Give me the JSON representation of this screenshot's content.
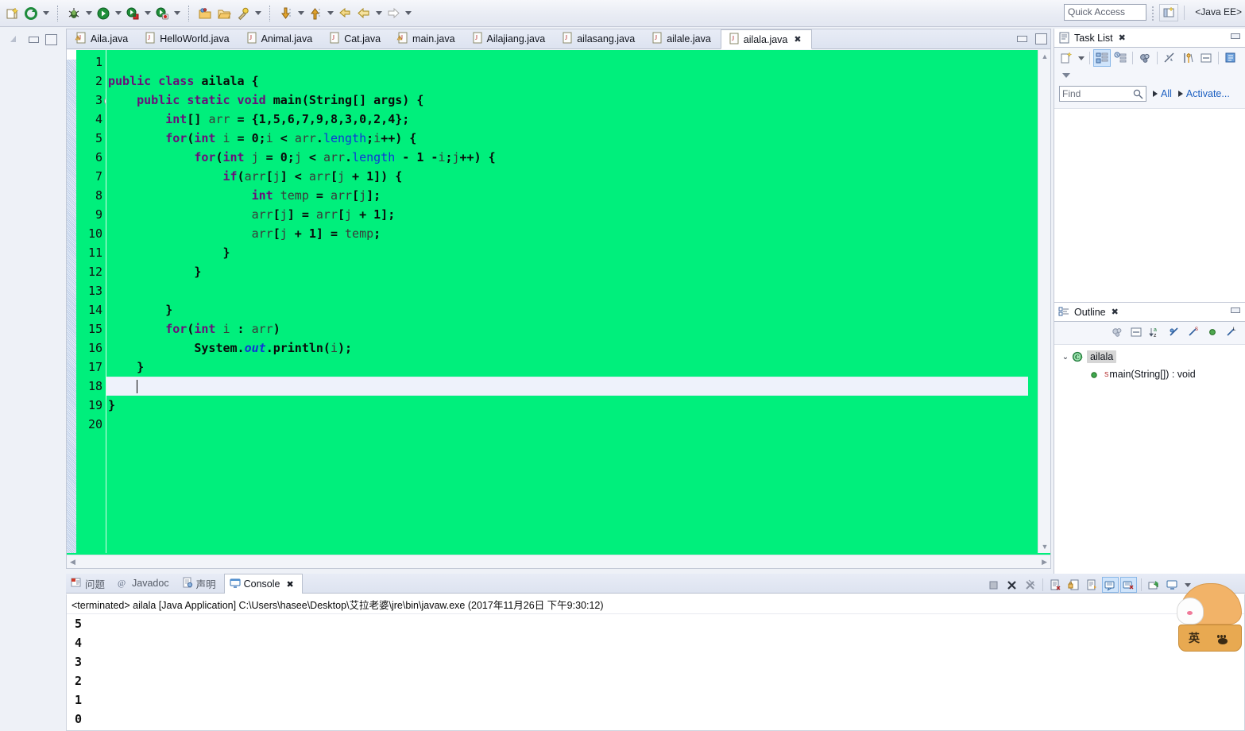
{
  "toolbar": {
    "buttons": [
      {
        "name": "new-wizard-icon",
        "label": "New"
      },
      {
        "name": "refresh-icon",
        "label": "Refresh"
      },
      {
        "name": "debug-icon",
        "label": "Debug"
      },
      {
        "name": "run-icon",
        "label": "Run"
      },
      {
        "name": "run-external-tools-icon",
        "label": "External Tools"
      },
      {
        "name": "run-as-server-icon",
        "label": "Run As"
      },
      {
        "name": "open-folder-icon",
        "label": "Open Resource"
      },
      {
        "name": "open-type-icon",
        "label": "Open Type"
      },
      {
        "name": "search-icon",
        "label": "Search"
      },
      {
        "name": "next-annotation-icon",
        "label": "Next Annotation"
      },
      {
        "name": "previous-annotation-icon",
        "label": "Previous Annotation"
      },
      {
        "name": "back-icon",
        "label": "Back"
      },
      {
        "name": "last-edit-icon",
        "label": "Last Edit Location"
      },
      {
        "name": "forward-icon",
        "label": "Forward"
      }
    ],
    "quick_access_placeholder": "Quick Access",
    "perspective_label": "<Java EE>",
    "perspective_open_icon": "open-perspective-icon"
  },
  "editor": {
    "tabs": [
      {
        "label": "Aila.java",
        "active": false,
        "warning": true
      },
      {
        "label": "HelloWorld.java",
        "active": false,
        "warning": false
      },
      {
        "label": "Animal.java",
        "active": false,
        "warning": false
      },
      {
        "label": "Cat.java",
        "active": false,
        "warning": false
      },
      {
        "label": "main.java",
        "active": false,
        "warning": true
      },
      {
        "label": "Ailajiang.java",
        "active": false,
        "warning": false
      },
      {
        "label": "ailasang.java",
        "active": false,
        "warning": false
      },
      {
        "label": "ailale.java",
        "active": false,
        "warning": false
      },
      {
        "label": "ailala.java",
        "active": true,
        "warning": false
      }
    ],
    "close_glyph": "✖",
    "background_color": "#00ef7c",
    "current_line_color": "#eef2fb",
    "line_numbers": [
      "1",
      "2",
      "3",
      "4",
      "5",
      "6",
      "7",
      "8",
      "9",
      "10",
      "11",
      "12",
      "13",
      "14",
      "15",
      "16",
      "17",
      "18",
      "19",
      "20"
    ],
    "current_line": 18,
    "fold_marker_line": 3,
    "code_lines": [
      {
        "n": 1,
        "tokens": []
      },
      {
        "n": 2,
        "tokens": [
          {
            "t": "public class ",
            "c": "kw"
          },
          {
            "t": "ailala {",
            "c": "plain"
          }
        ]
      },
      {
        "n": 3,
        "tokens": [
          {
            "t": "    public static void ",
            "c": "kw"
          },
          {
            "t": "main(String[] args) {",
            "c": "plain"
          }
        ]
      },
      {
        "n": 4,
        "tokens": [
          {
            "t": "        ",
            "c": "plain"
          },
          {
            "t": "int",
            "c": "kw"
          },
          {
            "t": "[] ",
            "c": "plain"
          },
          {
            "t": "arr",
            "c": "var"
          },
          {
            "t": " = {1,5,6,7,9,8,3,0,2,4};",
            "c": "plain"
          }
        ]
      },
      {
        "n": 5,
        "tokens": [
          {
            "t": "        ",
            "c": "plain"
          },
          {
            "t": "for",
            "c": "kw"
          },
          {
            "t": "(",
            "c": "plain"
          },
          {
            "t": "int",
            "c": "kw"
          },
          {
            "t": " ",
            "c": "plain"
          },
          {
            "t": "i",
            "c": "var"
          },
          {
            "t": " = ",
            "c": "plain"
          },
          {
            "t": "0;",
            "c": "plain"
          },
          {
            "t": "i",
            "c": "var"
          },
          {
            "t": " < ",
            "c": "plain"
          },
          {
            "t": "arr",
            "c": "var"
          },
          {
            "t": ".",
            "c": "plain"
          },
          {
            "t": "length",
            "c": "fld"
          },
          {
            "t": ";",
            "c": "plain"
          },
          {
            "t": "i",
            "c": "var"
          },
          {
            "t": "++) {",
            "c": "plain"
          }
        ]
      },
      {
        "n": 6,
        "tokens": [
          {
            "t": "            ",
            "c": "plain"
          },
          {
            "t": "for",
            "c": "kw"
          },
          {
            "t": "(",
            "c": "plain"
          },
          {
            "t": "int",
            "c": "kw"
          },
          {
            "t": " ",
            "c": "plain"
          },
          {
            "t": "j",
            "c": "var"
          },
          {
            "t": " = ",
            "c": "plain"
          },
          {
            "t": "0;",
            "c": "plain"
          },
          {
            "t": "j",
            "c": "var"
          },
          {
            "t": " < ",
            "c": "plain"
          },
          {
            "t": "arr",
            "c": "var"
          },
          {
            "t": ".",
            "c": "plain"
          },
          {
            "t": "length",
            "c": "fld"
          },
          {
            "t": " - 1 -",
            "c": "plain"
          },
          {
            "t": "i",
            "c": "var"
          },
          {
            "t": ";",
            "c": "plain"
          },
          {
            "t": "j",
            "c": "var"
          },
          {
            "t": "++) {",
            "c": "plain"
          }
        ]
      },
      {
        "n": 7,
        "tokens": [
          {
            "t": "                ",
            "c": "plain"
          },
          {
            "t": "if",
            "c": "kw"
          },
          {
            "t": "(",
            "c": "plain"
          },
          {
            "t": "arr",
            "c": "var"
          },
          {
            "t": "[",
            "c": "plain"
          },
          {
            "t": "j",
            "c": "var"
          },
          {
            "t": "] < ",
            "c": "plain"
          },
          {
            "t": "arr",
            "c": "var"
          },
          {
            "t": "[",
            "c": "plain"
          },
          {
            "t": "j",
            "c": "var"
          },
          {
            "t": " + 1]) {",
            "c": "plain"
          }
        ]
      },
      {
        "n": 8,
        "tokens": [
          {
            "t": "                    ",
            "c": "plain"
          },
          {
            "t": "int",
            "c": "kw"
          },
          {
            "t": " ",
            "c": "plain"
          },
          {
            "t": "temp",
            "c": "var"
          },
          {
            "t": " = ",
            "c": "plain"
          },
          {
            "t": "arr",
            "c": "var"
          },
          {
            "t": "[",
            "c": "plain"
          },
          {
            "t": "j",
            "c": "var"
          },
          {
            "t": "];",
            "c": "plain"
          }
        ]
      },
      {
        "n": 9,
        "tokens": [
          {
            "t": "                    ",
            "c": "plain"
          },
          {
            "t": "arr",
            "c": "var"
          },
          {
            "t": "[",
            "c": "plain"
          },
          {
            "t": "j",
            "c": "var"
          },
          {
            "t": "] = ",
            "c": "plain"
          },
          {
            "t": "arr",
            "c": "var"
          },
          {
            "t": "[",
            "c": "plain"
          },
          {
            "t": "j",
            "c": "var"
          },
          {
            "t": " + 1];",
            "c": "plain"
          }
        ]
      },
      {
        "n": 10,
        "tokens": [
          {
            "t": "                    ",
            "c": "plain"
          },
          {
            "t": "arr",
            "c": "var"
          },
          {
            "t": "[",
            "c": "plain"
          },
          {
            "t": "j",
            "c": "var"
          },
          {
            "t": " + 1] = ",
            "c": "plain"
          },
          {
            "t": "temp",
            "c": "var"
          },
          {
            "t": ";",
            "c": "plain"
          }
        ]
      },
      {
        "n": 11,
        "tokens": [
          {
            "t": "                }",
            "c": "plain"
          }
        ]
      },
      {
        "n": 12,
        "tokens": [
          {
            "t": "            }",
            "c": "plain"
          }
        ]
      },
      {
        "n": 13,
        "tokens": []
      },
      {
        "n": 14,
        "tokens": [
          {
            "t": "        }",
            "c": "plain"
          }
        ]
      },
      {
        "n": 15,
        "tokens": [
          {
            "t": "        ",
            "c": "plain"
          },
          {
            "t": "for",
            "c": "kw"
          },
          {
            "t": "(",
            "c": "plain"
          },
          {
            "t": "int",
            "c": "kw"
          },
          {
            "t": " ",
            "c": "plain"
          },
          {
            "t": "i",
            "c": "var"
          },
          {
            "t": " : ",
            "c": "plain"
          },
          {
            "t": "arr",
            "c": "var"
          },
          {
            "t": ")",
            "c": "plain"
          }
        ]
      },
      {
        "n": 16,
        "tokens": [
          {
            "t": "            System.",
            "c": "plain"
          },
          {
            "t": "out",
            "c": "sfld"
          },
          {
            "t": ".println(",
            "c": "plain"
          },
          {
            "t": "i",
            "c": "var"
          },
          {
            "t": ");",
            "c": "plain"
          }
        ]
      },
      {
        "n": 17,
        "tokens": [
          {
            "t": "    }",
            "c": "plain"
          }
        ]
      },
      {
        "n": 18,
        "tokens": [],
        "cursor": true
      },
      {
        "n": 19,
        "tokens": [
          {
            "t": "}",
            "c": "plain"
          }
        ]
      },
      {
        "n": 20,
        "tokens": []
      }
    ]
  },
  "console": {
    "tabs": [
      {
        "label": "问题",
        "icon": "problems-icon",
        "active": false
      },
      {
        "label": "Javadoc",
        "icon": "javadoc-icon",
        "active": false
      },
      {
        "label": "声明",
        "icon": "declaration-icon",
        "active": false
      },
      {
        "label": "Console",
        "icon": "console-icon",
        "active": true
      }
    ],
    "close_glyph": "✖",
    "terminated_line": "<terminated> ailala [Java Application] C:\\Users\\hasee\\Desktop\\艾拉老婆\\jre\\bin\\javaw.exe (2017年11月26日 下午9:30:12)",
    "output_lines": [
      "5",
      "4",
      "3",
      "2",
      "1",
      "0"
    ],
    "tool_buttons": [
      {
        "name": "terminate-all-icon",
        "selected": false
      },
      {
        "name": "remove-launch-icon",
        "selected": false
      },
      {
        "name": "remove-all-terminated-icon",
        "selected": false
      },
      {
        "name": "clear-console-icon",
        "selected": false
      },
      {
        "name": "scroll-lock-icon",
        "selected": false
      },
      {
        "name": "word-wrap-icon",
        "selected": false
      },
      {
        "name": "pin-console-icon",
        "selected": true
      },
      {
        "name": "display-selected-console-icon",
        "selected": true
      },
      {
        "name": "open-console-icon",
        "selected": false
      },
      {
        "name": "new-console-view-icon",
        "selected": false
      }
    ]
  },
  "task_list": {
    "title": "Task List",
    "close_glyph": "✖",
    "find_placeholder": "Find",
    "find_icon": "search-icon",
    "all_label": "All",
    "activate_label": "Activate...",
    "tool_buttons": [
      {
        "name": "new-task-icon",
        "selected": false
      },
      {
        "name": "categorized-presentation-icon",
        "selected": true
      },
      {
        "name": "scheduled-presentation-icon",
        "selected": false
      },
      {
        "name": "focus-on-workweek-icon",
        "selected": false
      },
      {
        "name": "synchronize-changed-icon",
        "selected": false
      },
      {
        "name": "collapse-all-icon",
        "selected": false
      },
      {
        "name": "restore-tasks-icon",
        "selected": false
      },
      {
        "name": "view-menu-icon",
        "selected": false
      }
    ]
  },
  "outline": {
    "title": "Outline",
    "close_glyph": "✖",
    "tool_buttons": [
      {
        "name": "focus-on-active-task-icon",
        "selected": false
      },
      {
        "name": "collapse-all-icon",
        "selected": false
      },
      {
        "name": "sort-icon",
        "selected": false
      },
      {
        "name": "hide-fields-icon",
        "selected": false
      },
      {
        "name": "hide-static-icon",
        "selected": false
      },
      {
        "name": "hide-non-public-icon",
        "selected": false
      },
      {
        "name": "hide-local-types-icon",
        "selected": false
      }
    ],
    "tree": [
      {
        "label": "ailala",
        "icon": "java-class-icon",
        "indent": 0,
        "selected": true,
        "expanded": true
      },
      {
        "label": "main(String[]) : void",
        "icon": "public-method-icon",
        "indent": 1,
        "selected": false,
        "static_marker": "S"
      }
    ]
  },
  "mascot": {
    "label": "英",
    "name": "sogou-ime-cat-mascot"
  }
}
